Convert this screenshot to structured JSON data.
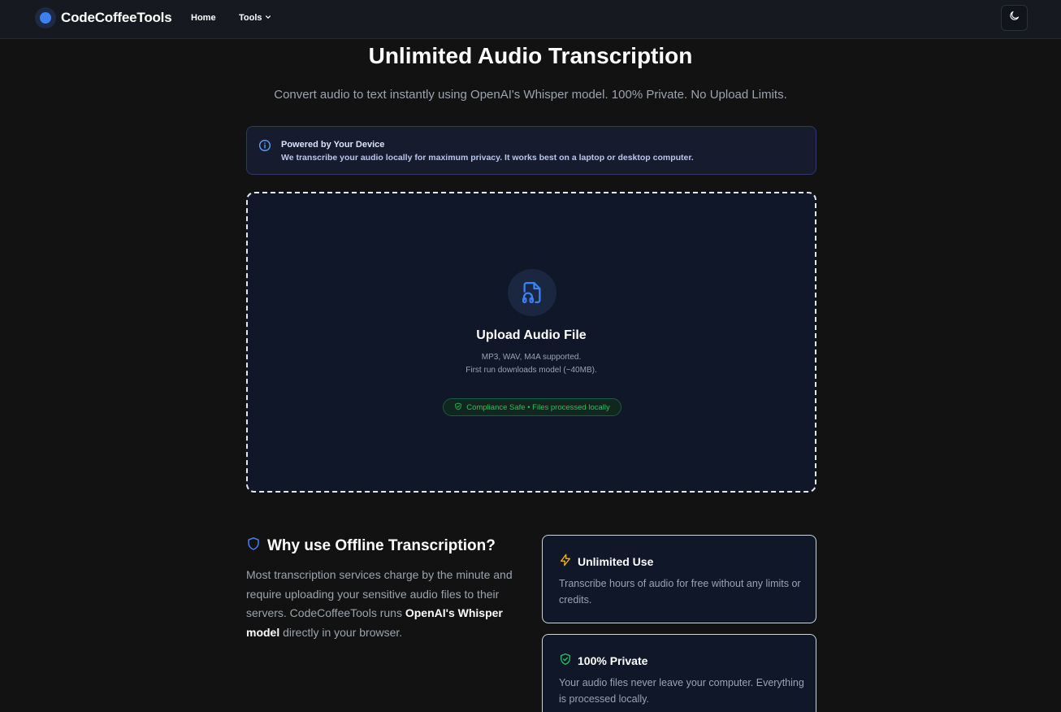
{
  "header": {
    "brand": "CodeCoffeeTools",
    "nav": {
      "home": "Home",
      "tools": "Tools"
    },
    "icons": {
      "theme_toggle": "moon-icon",
      "tools_dropdown": "chevron-down-icon"
    }
  },
  "hero": {
    "title": "Unlimited Audio Transcription",
    "subtitle": "Convert audio to text instantly using OpenAI's Whisper model. 100% Private. No Upload Limits."
  },
  "info_banner": {
    "icon": "info-icon",
    "title": "Powered by Your Device",
    "text": "We transcribe your audio locally for maximum privacy. It works best on a laptop or desktop computer."
  },
  "upload": {
    "icon": "file-audio-icon",
    "title": "Upload Audio File",
    "formats": "MP3, WAV, M4A supported.",
    "note": "First run downloads model (~40MB).",
    "badge": "Compliance Safe • Files processed locally"
  },
  "why": {
    "icon": "shield-icon",
    "heading": "Why use Offline Transcription?",
    "text_before": "Most transcription services charge by the minute and require uploading your sensitive audio files to their servers. CodeCoffeeTools runs ",
    "text_bold": "OpenAI's Whisper model",
    "text_after": " directly in your browser."
  },
  "features": [
    {
      "icon": "lightning-icon",
      "title": "Unlimited Use",
      "text": "Transcribe hours of audio for free without any limits or credits."
    },
    {
      "icon": "shield-check-icon",
      "title": "100% Private",
      "text": "Your audio files never leave your computer. Everything is processed locally."
    }
  ],
  "colors": {
    "background": "#121212",
    "accent_blue": "#3b82f6",
    "success_green": "#22c55e",
    "warning_yellow": "#eab308",
    "card_background": "#0f1729"
  }
}
